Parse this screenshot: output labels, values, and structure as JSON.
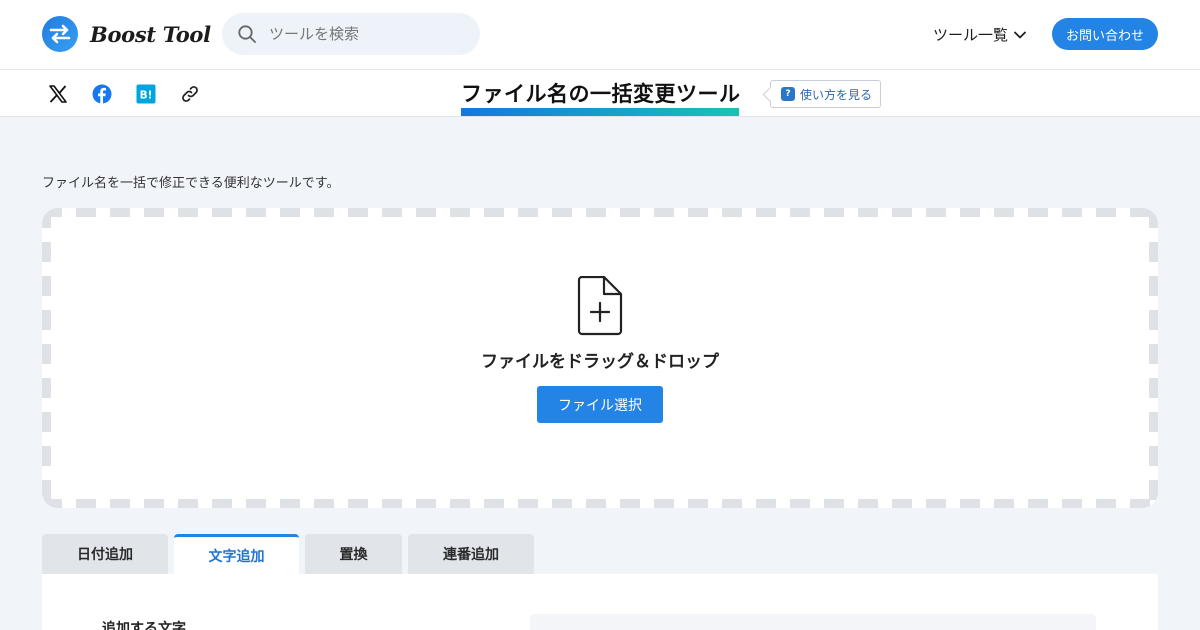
{
  "header": {
    "logo_text": "Boost Tool",
    "search_placeholder": "ツールを検索",
    "tool_menu_label": "ツール一覧",
    "contact_label": "お問い合わせ"
  },
  "subheader": {
    "share_icons": [
      "x-icon",
      "facebook-icon",
      "hatena-bookmark-icon",
      "link-icon"
    ],
    "hatena_label": "B!",
    "page_title": "ファイル名の一括変更ツール",
    "howto_icon": "?",
    "howto_label": "使い方を見る"
  },
  "main": {
    "description": "ファイル名を一括で修正できる便利なツールです。",
    "drop_label": "ファイルをドラッグ＆ドロップ",
    "select_button": "ファイル選択",
    "tabs": [
      {
        "label": "日付追加",
        "active": false
      },
      {
        "label": "文字追加",
        "active": true
      },
      {
        "label": "置換",
        "active": false
      },
      {
        "label": "連番追加",
        "active": false
      }
    ],
    "panel_label": "追加する文字"
  },
  "colors": {
    "accent": "#2384e5",
    "page_bg": "#f1f5fa",
    "title_gradient_start": "#1477e0",
    "title_gradient_end": "#18c3b4"
  }
}
